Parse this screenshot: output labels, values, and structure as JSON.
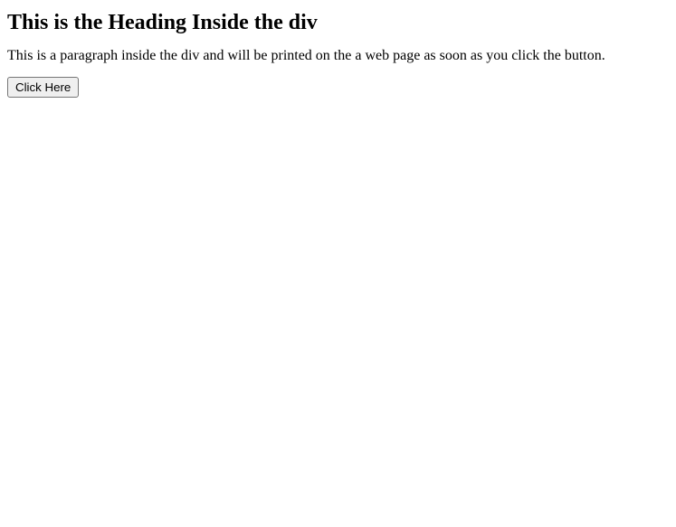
{
  "heading": "This is the Heading Inside the div",
  "paragraph": "This is a paragraph inside the div and will be printed on the a web page as soon as you click the button.",
  "button_label": "Click Here"
}
